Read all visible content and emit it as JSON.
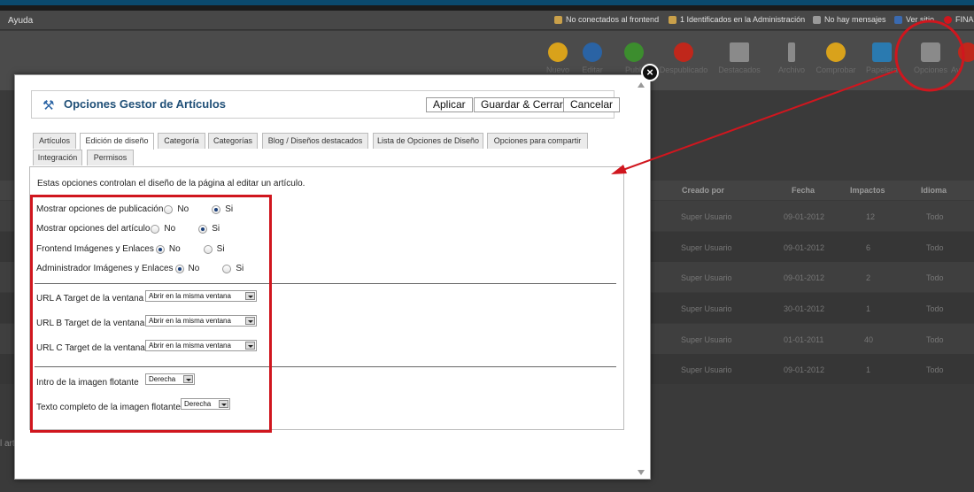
{
  "background": {
    "brand": "Ayuda",
    "status": [
      {
        "label": "No conectados al frontend",
        "color": "#c9a04a"
      },
      {
        "label": "1 Identificados en la Administración",
        "color": "#c9a04a"
      },
      {
        "label": "No hay mensajes",
        "color": "#9a9a9a"
      },
      {
        "label": "Ver sitio",
        "color": "#3a6ab0"
      },
      {
        "label": "FINA",
        "color": "#d0161e"
      }
    ],
    "toolbar": [
      {
        "label": "Nuevo",
        "color": "#d9a21b"
      },
      {
        "label": "Editar",
        "color": "#2a63a4"
      },
      {
        "label": "Publi",
        "color": "#3c8d2e"
      },
      {
        "label": "Despublicado",
        "color": "#c0271b"
      },
      {
        "label": "Destacados",
        "color": "#8a8a8a"
      },
      {
        "label": "Archivo",
        "color": "#8a8a8a"
      },
      {
        "label": "Comprobar",
        "color": "#d9a21b"
      },
      {
        "label": "Papelera",
        "color": "#2a7ab0"
      },
      {
        "label": "Opciones",
        "color": "#8a8a8a"
      },
      {
        "label": "Ay",
        "color": "#c0271b"
      }
    ],
    "table_headers": [
      "Creado por",
      "Fecha",
      "Impactos",
      "Idioma"
    ],
    "rows": [
      [
        "Super Usuario",
        "09-01-2012",
        "12",
        "Todo"
      ],
      [
        "Super Usuario",
        "09-01-2012",
        "6",
        "Todo"
      ],
      [
        "Super Usuario",
        "09-01-2012",
        "2",
        "Todo"
      ],
      [
        "Super Usuario",
        "30-01-2012",
        "1",
        "Todo"
      ],
      [
        "Super Usuario",
        "01-01-2011",
        "40",
        "Todo"
      ],
      [
        "Super Usuario",
        "09-01-2012",
        "1",
        "Todo"
      ]
    ],
    "bottom_text": "l art"
  },
  "modal": {
    "close_symbol": "×",
    "title": "Opciones Gestor de Artículos",
    "buttons": {
      "apply": "Aplicar",
      "save_close": "Guardar & Cerrar",
      "cancel": "Cancelar"
    },
    "tabs": [
      "Artículos",
      "Edición de diseño",
      "Categoría",
      "Categorías",
      "Blog / Diseños destacados",
      "Lista de Opciones de Diseño",
      "Opciones para compartir",
      "Integración",
      "Permisos"
    ],
    "active_tab": "Edición de diseño",
    "description": "Estas opciones controlan el diseño de la página al editar un artículo.",
    "radio_options": [
      {
        "label": "Mostrar opciones de publicación",
        "no": "No",
        "yes": "Si",
        "selected": "yes"
      },
      {
        "label": "Mostrar opciones del artículo",
        "no": "No",
        "yes": "Si",
        "selected": "yes"
      },
      {
        "label": "Frontend Imágenes y Enlaces",
        "no": "No",
        "yes": "Si",
        "selected": "no"
      },
      {
        "label": "Administrador Imágenes y Enlaces",
        "no": "No",
        "yes": "Si",
        "selected": "no"
      }
    ],
    "url_targets": [
      {
        "label": "URL A Target de la ventana",
        "value": "Abrir en la misma ventana"
      },
      {
        "label": "URL B Target de la ventana",
        "value": "Abrir en la misma ventana"
      },
      {
        "label": "URL C Target de la ventana",
        "value": "Abrir en la misma ventana"
      }
    ],
    "float_options": [
      {
        "label": "Intro de la imagen flotante",
        "value": "Derecha"
      },
      {
        "label": "Texto completo de la imagen flotante",
        "value": "Derecha"
      }
    ]
  },
  "annotation_color": "#d0161e"
}
